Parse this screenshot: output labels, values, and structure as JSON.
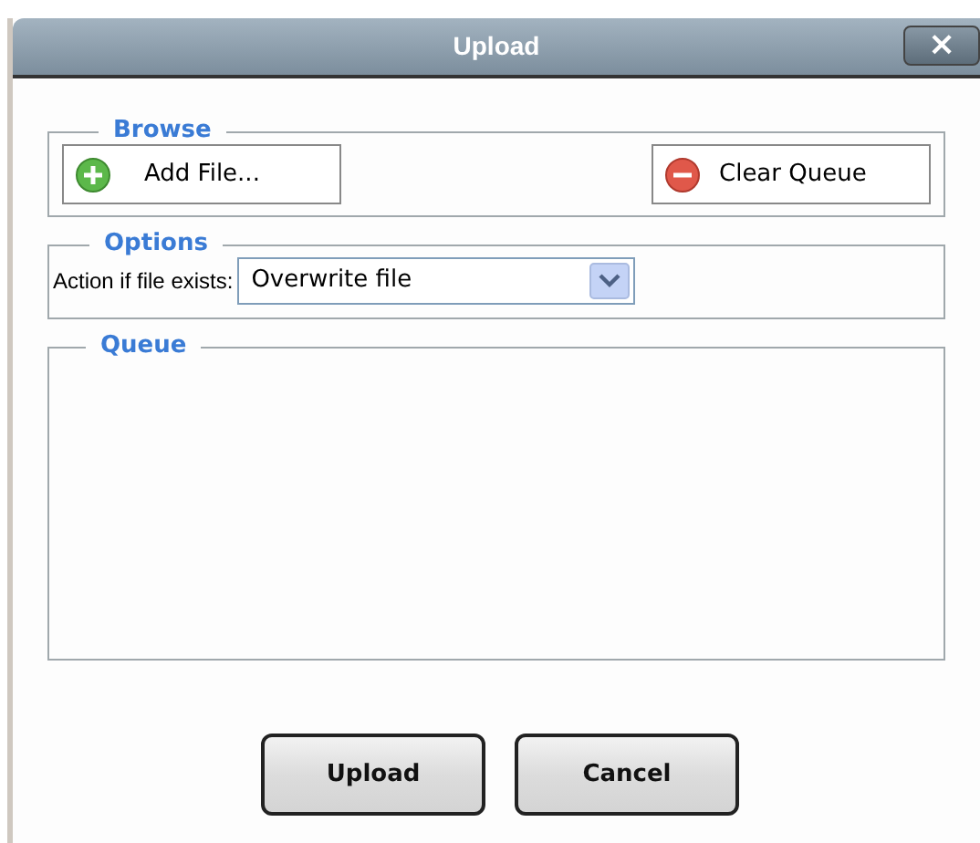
{
  "window": {
    "title": "Upload",
    "close": "×"
  },
  "browse": {
    "legend": "Browse",
    "add_button": "Add File...",
    "clear_button": "Clear Queue"
  },
  "options": {
    "legend": "Options",
    "label": "Action if file exists:",
    "value": "Overwrite file"
  },
  "queue": {
    "legend": "Queue"
  },
  "buttons": [
    "Upload",
    "Cancel"
  ]
}
